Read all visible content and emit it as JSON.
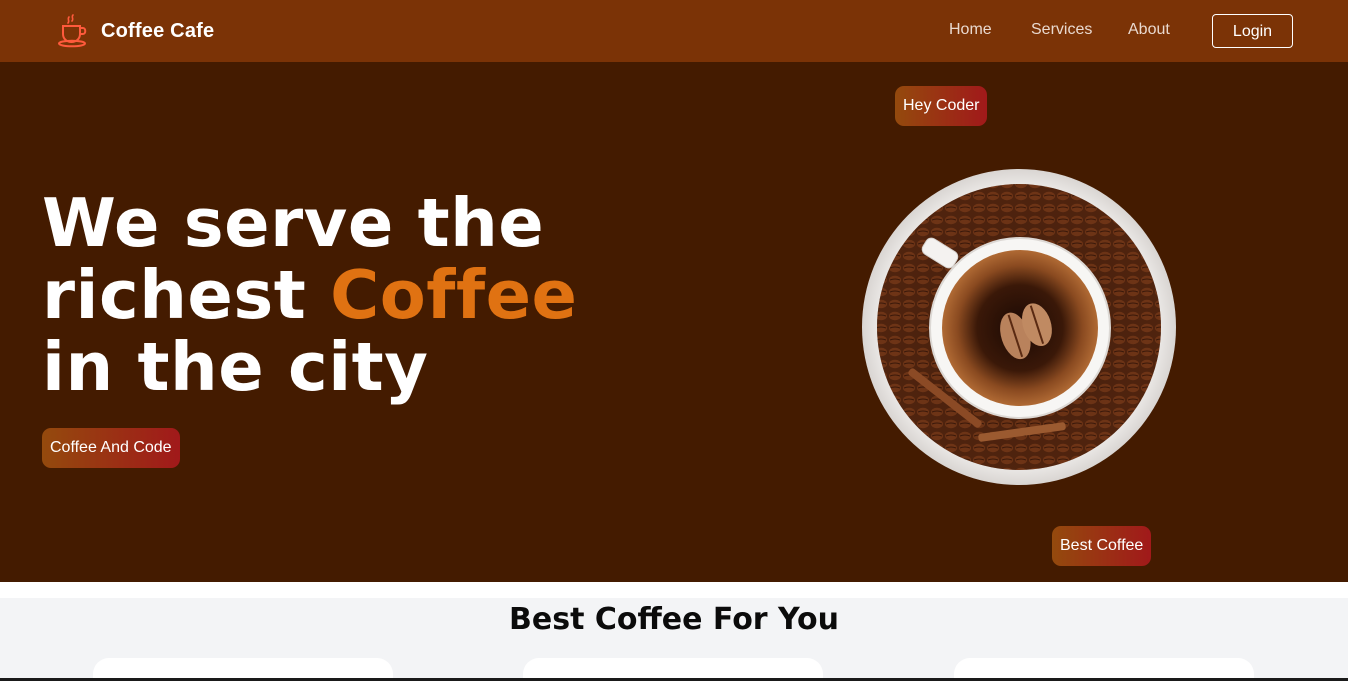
{
  "navbar": {
    "brand_name": "Coffee Cafe",
    "brand_icon": "coffee-cup-icon",
    "links": [
      {
        "label": "Home"
      },
      {
        "label": "Services"
      },
      {
        "label": "About"
      }
    ],
    "login_label": "Login",
    "background_color": "#7b3306"
  },
  "hero": {
    "title_part1": "We serve the richest ",
    "title_accent": "Coffee",
    "title_part2": " in the city",
    "tag_coffee_code": "Coffee And Code",
    "tag_hey_coder": "Hey Coder",
    "tag_best_coffee": "Best Coffee",
    "image_semantic": "coffee-cup-with-beans-image",
    "background_color": "#441b00",
    "accent_color": "#e07212"
  },
  "section": {
    "title": "Best Coffee For You",
    "cards": [
      {},
      {},
      {}
    ]
  }
}
